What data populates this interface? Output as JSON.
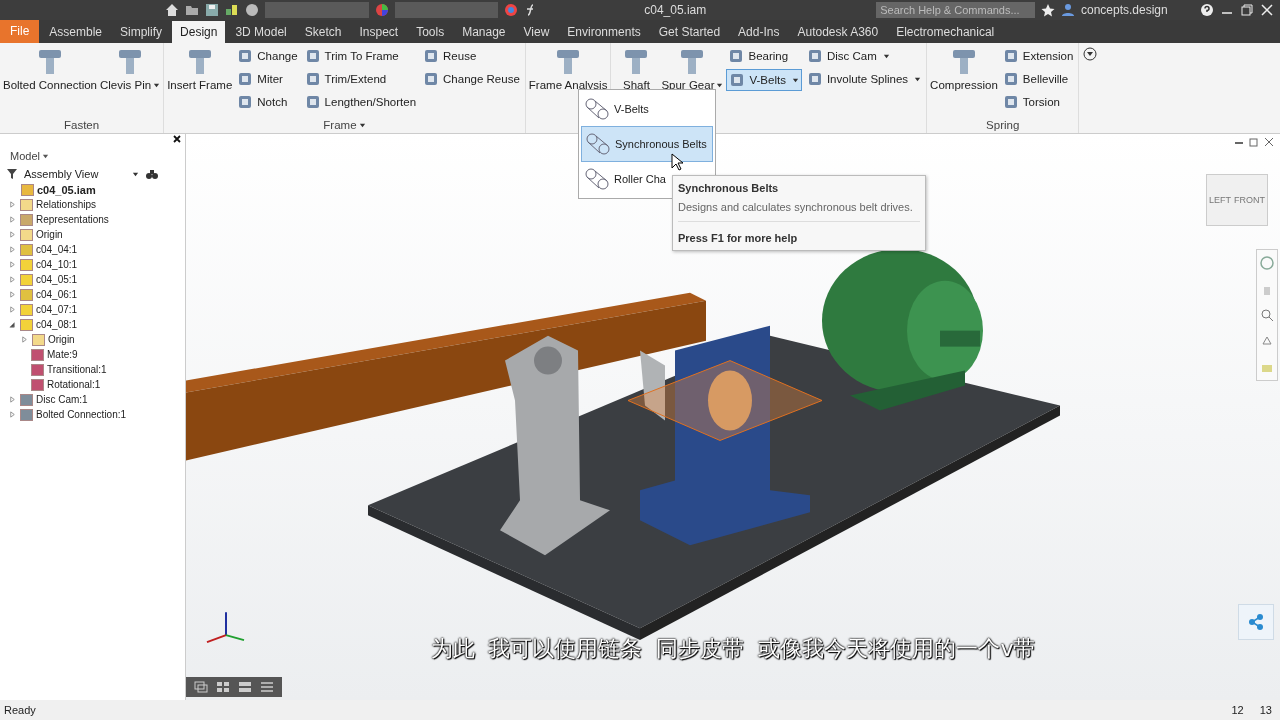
{
  "title_bar": {
    "title": "c04_05.iam",
    "search": {
      "placeholder": "Search Help & Commands..."
    },
    "user": "concepts.design"
  },
  "tabs": [
    {
      "label": "File",
      "kind": "file",
      "selected": false
    },
    {
      "label": "Assemble",
      "kind": "tab",
      "selected": false
    },
    {
      "label": "Simplify",
      "kind": "tab",
      "selected": false
    },
    {
      "label": "Design",
      "kind": "tab",
      "selected": true
    },
    {
      "label": "3D Model",
      "kind": "tab",
      "selected": false
    },
    {
      "label": "Sketch",
      "kind": "tab",
      "selected": false
    },
    {
      "label": "Inspect",
      "kind": "tab",
      "selected": false
    },
    {
      "label": "Tools",
      "kind": "tab",
      "selected": false
    },
    {
      "label": "Manage",
      "kind": "tab",
      "selected": false
    },
    {
      "label": "View",
      "kind": "tab",
      "selected": false
    },
    {
      "label": "Environments",
      "kind": "tab",
      "selected": false
    },
    {
      "label": "Get Started",
      "kind": "tab",
      "selected": false
    },
    {
      "label": "Add-Ins",
      "kind": "tab",
      "selected": false
    },
    {
      "label": "Autodesk A360",
      "kind": "tab",
      "selected": false
    },
    {
      "label": "Electromechanical",
      "kind": "tab",
      "selected": false
    }
  ],
  "ribbon": [
    {
      "label": "Fasten",
      "columns": [
        [
          {
            "label": "Bolted Connection",
            "kind": "large"
          }
        ],
        [
          {
            "label": "Clevis Pin",
            "kind": "large",
            "dropdown": true
          }
        ]
      ]
    },
    {
      "label": "Frame",
      "menu": true,
      "columns": [
        [
          {
            "label": "Insert Frame",
            "kind": "large"
          }
        ],
        [
          {
            "label": "Change",
            "kind": "small"
          },
          {
            "label": "Miter",
            "kind": "small"
          },
          {
            "label": "Notch",
            "kind": "small"
          }
        ],
        [
          {
            "label": "Trim To Frame",
            "kind": "small"
          },
          {
            "label": "Trim/Extend",
            "kind": "small"
          },
          {
            "label": "Lengthen/Shorten",
            "kind": "small"
          }
        ],
        [
          {
            "label": "Reuse",
            "kind": "small"
          },
          {
            "label": "Change Reuse",
            "kind": "small"
          }
        ]
      ]
    },
    {
      "columns": [
        [
          {
            "label": "Frame Analysis",
            "kind": "large"
          }
        ]
      ]
    },
    {
      "columns": [
        [
          {
            "label": "Shaft",
            "kind": "large"
          }
        ],
        [
          {
            "label": "Spur Gear",
            "kind": "large",
            "dropdown": true
          }
        ],
        [
          {
            "label": "Bearing",
            "kind": "small"
          },
          {
            "label": "V-Belts",
            "kind": "small",
            "dropdown": true,
            "pressed": true
          }
        ],
        [
          {
            "label": "Disc Cam",
            "kind": "small",
            "dropdown": true
          },
          {
            "label": "Involute Splines",
            "kind": "small",
            "dropdown": true
          }
        ]
      ]
    },
    {
      "label": "Spring",
      "columns": [
        [
          {
            "label": "Compression",
            "kind": "large"
          }
        ],
        [
          {
            "label": "Extension",
            "kind": "small"
          },
          {
            "label": "Belleville",
            "kind": "small"
          },
          {
            "label": "Torsion",
            "kind": "small"
          }
        ]
      ]
    }
  ],
  "dropdown_menu": [
    {
      "label": "V-Belts",
      "selected": false
    },
    {
      "label": "Synchronous Belts",
      "selected": true
    },
    {
      "label": "Roller Cha",
      "selected": false
    }
  ],
  "tooltip": {
    "title": "Synchronous Belts",
    "description": "Designs and calculates synchronous belt drives.",
    "help": "Press F1 for more help"
  },
  "browser": {
    "title": "Model",
    "view": "Assembly View",
    "tree": [
      {
        "label": "c04_05.iam",
        "kind": "assembly",
        "children": [
          {
            "label": "Relationships",
            "kind": "folder",
            "expanded": false
          },
          {
            "label": "Representations",
            "kind": "representation",
            "expanded": false
          },
          {
            "label": "Origin",
            "kind": "folder",
            "expanded": false
          },
          {
            "label": "c04_04:1",
            "kind": "subassembly",
            "expanded": false
          },
          {
            "label": "c04_10:1",
            "kind": "part",
            "expanded": false
          },
          {
            "label": "c04_05:1",
            "kind": "part",
            "expanded": false
          },
          {
            "label": "c04_06:1",
            "kind": "subassembly",
            "expanded": false
          },
          {
            "label": "c04_07:1",
            "kind": "part",
            "expanded": false
          },
          {
            "label": "c04_08:1",
            "kind": "part",
            "expanded": true,
            "children": [
              {
                "label": "Origin",
                "kind": "folder",
                "expanded": false
              },
              {
                "label": "Mate:9",
                "kind": "constraint"
              },
              {
                "label": "Transitional:1",
                "kind": "constraint"
              },
              {
                "label": "Rotational:1",
                "kind": "constraint"
              }
            ]
          },
          {
            "label": "Disc Cam:1",
            "kind": "component",
            "expanded": false
          },
          {
            "label": "Bolted Connection:1",
            "kind": "component",
            "expanded": false
          }
        ]
      }
    ]
  },
  "view_cube": {
    "left": "LEFT",
    "front": "FRONT"
  },
  "subtitle": "为此  我可以使用链条  同步皮带  或像我今天将使用的一个v带",
  "status_bar": {
    "text": "Ready",
    "counts": [
      "12",
      "13"
    ]
  }
}
